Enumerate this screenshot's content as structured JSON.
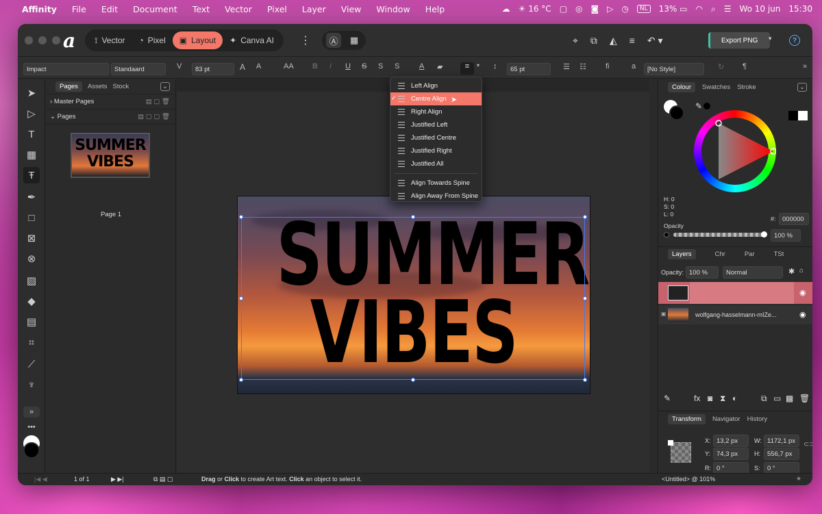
{
  "menubar": {
    "app": "Affinity",
    "items": [
      "File",
      "Edit",
      "Document",
      "Text",
      "Vector",
      "Pixel",
      "Layer",
      "View",
      "Window",
      "Help"
    ],
    "weather": "16 °C",
    "lang": "NL",
    "battery": "13%",
    "date": "Wo 10 jun",
    "time": "15:30"
  },
  "toolbar": {
    "personas": [
      "Vector",
      "Pixel",
      "Layout",
      "Canva AI"
    ],
    "active_persona": "Layout",
    "export_label": "Export PNG"
  },
  "context": {
    "font": "Impact",
    "style": "Standaard",
    "size": "83 pt",
    "leading": "65 pt",
    "text_style": "[No Style]",
    "size_up": "A",
    "size_down": "A",
    "caps": "AA",
    "bold": "B",
    "italic": "I",
    "underline": "U",
    "strike": "S",
    "super": "S",
    "sub": "S",
    "fi": "fi",
    "a": "a"
  },
  "pages_panel": {
    "tabs": [
      "Pages",
      "Assets",
      "Stock"
    ],
    "master_pages": "Master Pages",
    "pages": "Pages",
    "page1": "Page 1",
    "thumb_line1": "SUMMER",
    "thumb_line2": "VIBES"
  },
  "canvas": {
    "doc_tab": "<U",
    "line1": "SUMMER",
    "line2": "VIBES"
  },
  "align_menu": {
    "items": [
      "Left Align",
      "Centre Align",
      "Right Align",
      "Justified Left",
      "Justified Centre",
      "Justified Right",
      "Justified All"
    ],
    "items2": [
      "Align Towards Spine",
      "Align Away From Spine"
    ],
    "selected": "Centre Align"
  },
  "colour_panel": {
    "tabs": [
      "Colour",
      "Swatches",
      "Stroke"
    ],
    "h": "H: 0",
    "s": "S: 0",
    "l": "L: 0",
    "hex_label": "#:",
    "hex": "000000",
    "opacity_label": "Opacity",
    "opacity": "100 %"
  },
  "layers_panel": {
    "tabs": [
      "Layers",
      "Chr",
      "Par",
      "TSt"
    ],
    "opacity_label": "Opacity:",
    "opacity": "100 %",
    "blend": "Normal",
    "layer2": "wolfgang-hasselmann-mIZe..."
  },
  "transform_panel": {
    "tabs": [
      "Transform",
      "Navigator",
      "History"
    ],
    "x_label": "X:",
    "x": "13,2 px",
    "w_label": "W:",
    "w": "1172,1 px",
    "y_label": "Y:",
    "y": "74,3 px",
    "h_label": "H:",
    "h": "556,7 px",
    "r_label": "R:",
    "r": "0 °",
    "s_label": "S:",
    "s": "0 °"
  },
  "status": {
    "page": "1 of 1",
    "hint_drag": "Drag",
    "hint_or": " or ",
    "hint_click": "Click",
    "hint_mid": " to create Art text. ",
    "hint_click2": "Click",
    "hint_end": " an object to select it.",
    "doc": "<Untitled> @ 101%"
  }
}
